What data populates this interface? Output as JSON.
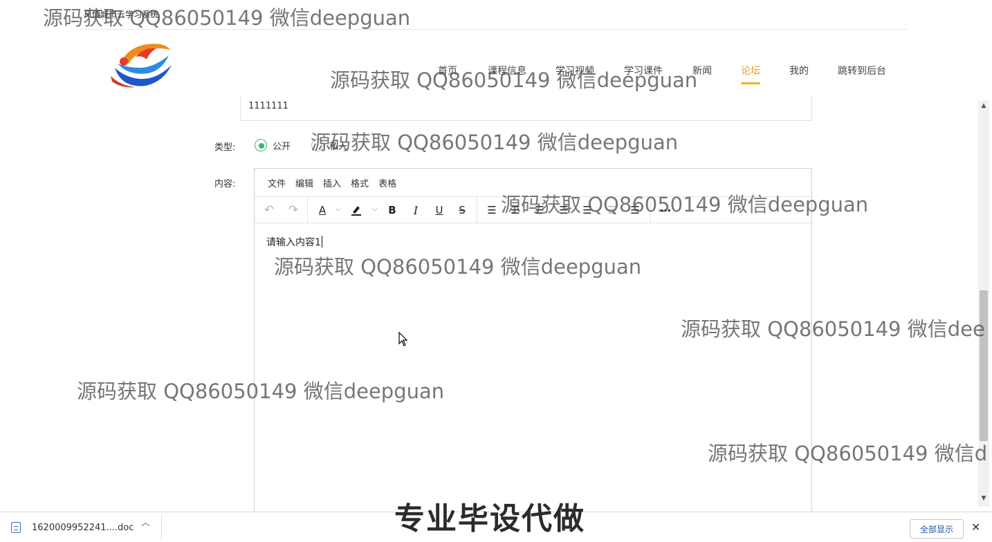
{
  "site": {
    "title": "风情城市云学习系统"
  },
  "nav": {
    "items": [
      {
        "label": "首页"
      },
      {
        "label": "课程信息"
      },
      {
        "label": "学习视频"
      },
      {
        "label": "学习课件"
      },
      {
        "label": "新闻"
      },
      {
        "label": "论坛",
        "active": true
      },
      {
        "label": "我的"
      },
      {
        "label": "跳转到后台"
      }
    ],
    "active_color": "#e8a317"
  },
  "form": {
    "title_value": "1111111",
    "type_label": "类型:",
    "type_options": [
      {
        "label": "公开",
        "checked": true
      },
      {
        "label": "私人",
        "checked": false
      }
    ],
    "content_label": "内容:",
    "accent_color": "#3bb27a"
  },
  "editor": {
    "menu": [
      "文件",
      "编辑",
      "插入",
      "格式",
      "表格"
    ],
    "toolbar_icons": [
      "undo-icon",
      "redo-icon",
      "text-color-icon",
      "highlight-icon",
      "bold-icon",
      "italic-icon",
      "underline-icon",
      "strikethrough-icon",
      "align-left-icon",
      "align-center-icon",
      "align-right-icon",
      "align-justify-icon",
      "indent-icon",
      "outdent-icon",
      "more-icon"
    ],
    "content_text": "请输入内容1"
  },
  "watermark": {
    "text": "源码获取 QQ86050149 微信deepguan",
    "text_cut_a": "源码获取 QQ86050149 微信dee",
    "text_cut_b": "源码获取 QQ86050149 微信d",
    "banner": "专业毕设代做"
  },
  "downloads": {
    "file_name": "1620009952241....doc",
    "show_all": "全部显示"
  }
}
